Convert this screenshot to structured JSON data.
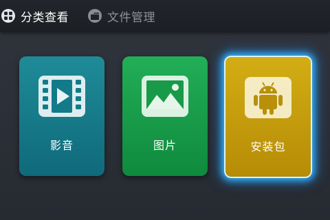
{
  "header": {
    "tabs": [
      {
        "label": "分类查看",
        "icon": "grid-icon",
        "active": true
      },
      {
        "label": "文件管理",
        "icon": "folder-icon",
        "active": false
      }
    ]
  },
  "categories": [
    {
      "label": "影音",
      "icon": "video-film-icon",
      "color": "#137a8a"
    },
    {
      "label": "图片",
      "icon": "picture-icon",
      "color": "#189a48"
    },
    {
      "label": "安装包",
      "icon": "android-icon",
      "color": "#c79d0c",
      "selected": true
    }
  ],
  "colors": {
    "background": "#2c3038",
    "topbar": "#1e2126",
    "focus_glow": "#34b5ff"
  }
}
